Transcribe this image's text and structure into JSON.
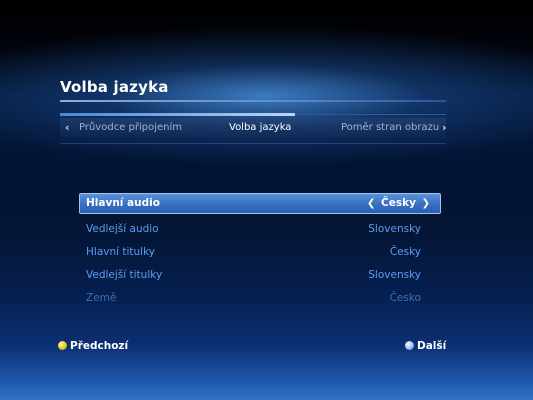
{
  "header": {
    "title": "Volba jazyka"
  },
  "tabs": {
    "prev_arrow": "‹",
    "next_arrow": "›",
    "items": [
      {
        "label": "Průvodce připojením"
      },
      {
        "label": "Volba jazyka"
      },
      {
        "label": "Poměr stran obrazu"
      }
    ],
    "active_index": 1,
    "progress_fraction": 0.61
  },
  "menu": {
    "items": [
      {
        "label": "Hlavní audio",
        "value": "Česky",
        "state": "selected"
      },
      {
        "label": "Vedlejší audio",
        "value": "Slovensky",
        "state": "normal"
      },
      {
        "label": "Hlavní titulky",
        "value": "Česky",
        "state": "normal"
      },
      {
        "label": "Vedlejší titulky",
        "value": "Slovensky",
        "state": "normal"
      },
      {
        "label": "Země",
        "value": "Česko",
        "state": "dim"
      }
    ],
    "value_prev_arrow": "❮",
    "value_next_arrow": "❯"
  },
  "footer": {
    "left_label": "Předchozí",
    "left_button_color": "yellow",
    "right_label": "Další",
    "right_button_color": "blue"
  },
  "colors": {
    "accent": "#5d9df0",
    "selected_bg": "#3a72c2",
    "dim_text": "#3e6fae"
  }
}
